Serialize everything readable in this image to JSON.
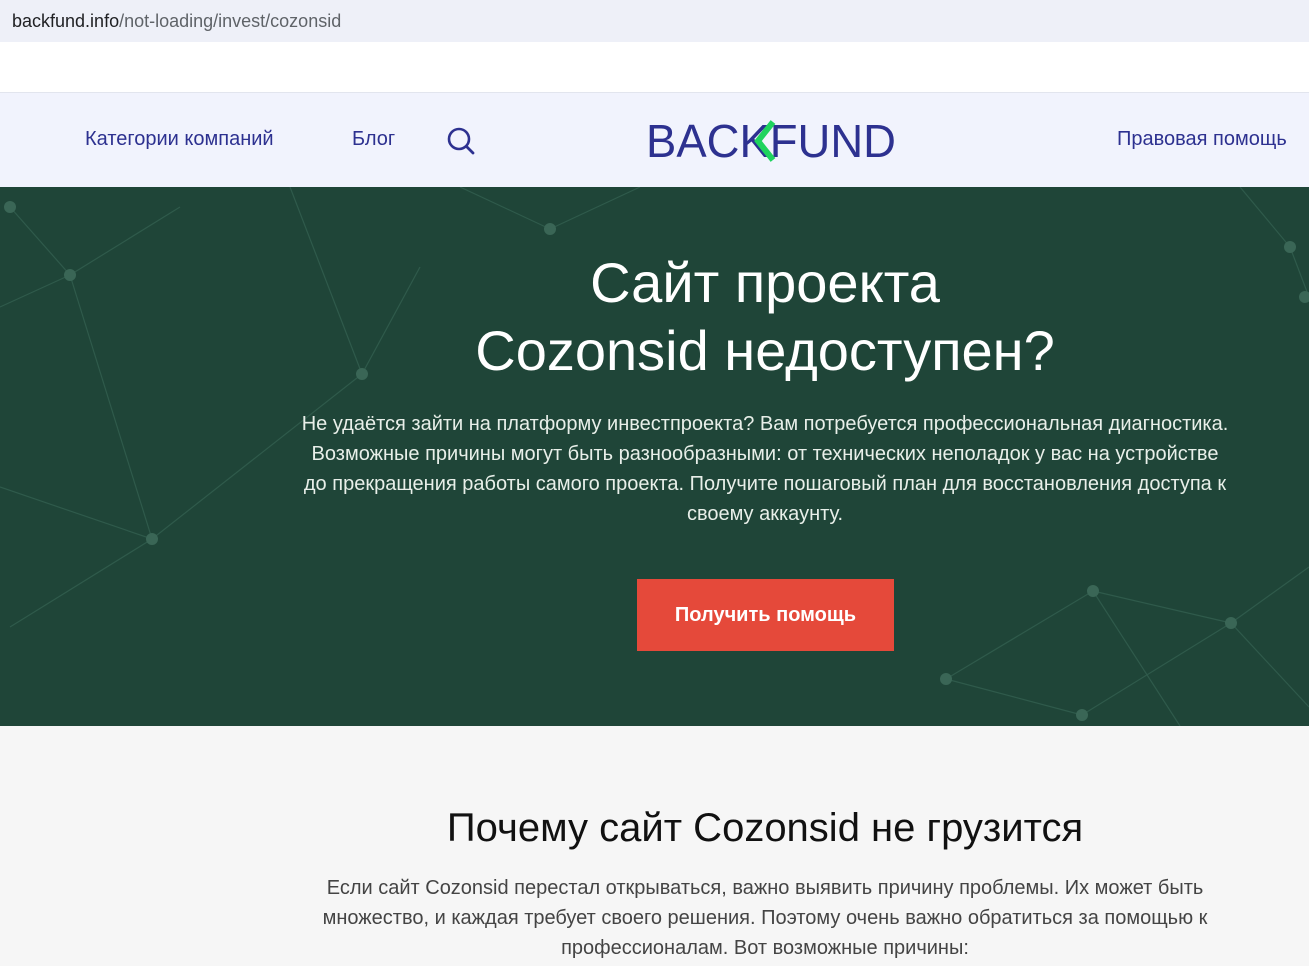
{
  "browser": {
    "url_host": "backfund.info",
    "url_path": "/not-loading/invest/cozonsid"
  },
  "header": {
    "nav_categories": "Категории компаний",
    "nav_blog": "Блог",
    "search_icon": "search-icon",
    "logo_text": "BACKFUND",
    "nav_legal": "Правовая помощь"
  },
  "hero": {
    "title_line1": "Сайт проекта",
    "title_line2": "Cozonsid недоступен?",
    "description": "Не удаётся зайти на платформу инвестпроекта? Вам потребуется профессиональная диагностика. Возможные причины могут быть разнообразными: от технических неполадок у вас на устройстве до прекращения работы самого проекта. Получите пошаговый план для восстановления доступа к своему аккаунту.",
    "cta_label": "Получить помощь"
  },
  "section": {
    "title": "Почему сайт Cozonsid не грузится",
    "text": "Если сайт Cozonsid перестал открываться, важно выявить причину проблемы. Их может быть множество, и каждая требует своего решения. Поэтому очень важно обратиться за помощью к профессионалам. Вот возможные причины:"
  },
  "colors": {
    "nav_text": "#2d3190",
    "logo_accent": "#1fd35e",
    "hero_bg": "#1f4538",
    "cta_bg": "#e5493a"
  }
}
